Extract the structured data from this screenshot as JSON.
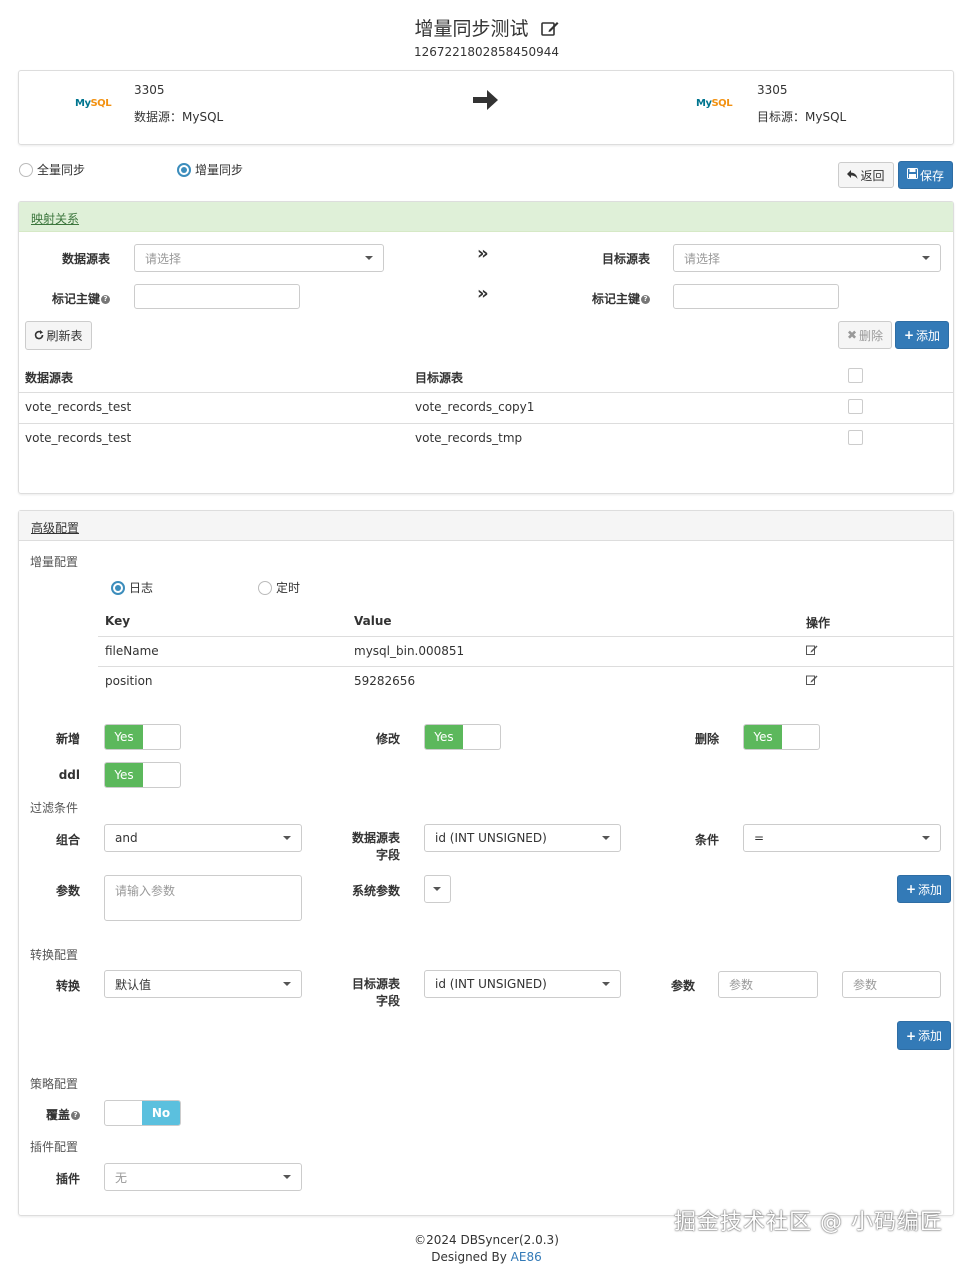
{
  "header": {
    "title": "增量同步测试",
    "id": "1267221802858450944"
  },
  "source": {
    "port": "3305",
    "label": "数据源：MySQL",
    "logo_main": "My",
    "logo_accent": "SQL"
  },
  "target": {
    "port": "3305",
    "label": "目标源：MySQL",
    "logo_main": "My",
    "logo_accent": "SQL"
  },
  "sync_mode": {
    "full": "全量同步",
    "incremental": "增量同步",
    "selected": "incremental"
  },
  "actions": {
    "back": "返回",
    "save": "保存"
  },
  "mapping": {
    "title": "映射关系",
    "source_table_label": "数据源表",
    "target_table_label": "目标源表",
    "source_pk_label": "标记主键",
    "target_pk_label": "标记主键",
    "select_placeholder": "请选择",
    "refresh": "刷新表",
    "delete": "删除",
    "add": "添加",
    "columns": [
      "数据源表",
      "目标源表"
    ],
    "rows": [
      {
        "source": "vote_records_test",
        "target": "vote_records_copy1"
      },
      {
        "source": "vote_records_test",
        "target": "vote_records_tmp"
      }
    ]
  },
  "advanced": {
    "title": "高级配置",
    "incremental_label": "增量配置",
    "mode_log": "日志",
    "mode_timer": "定时",
    "mode_selected": "log",
    "kv_headers": {
      "key": "Key",
      "value": "Value",
      "op": "操作"
    },
    "kv_rows": [
      {
        "key": "fileName",
        "value": "mysql_bin.000851"
      },
      {
        "key": "position",
        "value": "59282656"
      }
    ],
    "insert_label": "新增",
    "update_label": "修改",
    "delete_label": "删除",
    "ddl_label": "ddl",
    "yes": "Yes",
    "no": "No",
    "filter_label": "过滤条件",
    "combine_label": "组合",
    "combine_value": "and",
    "src_field_label_1": "数据源表",
    "src_field_label_2": "字段",
    "src_field_value": "id (INT UNSIGNED)",
    "condition_label": "条件",
    "condition_value": "=",
    "param_label": "参数",
    "param_placeholder": "请输入参数",
    "sys_param_label": "系统参数",
    "add": "添加",
    "convert_section_label": "转换配置",
    "convert_label": "转换",
    "convert_value": "默认值",
    "tgt_field_label_1": "目标源表",
    "tgt_field_label_2": "字段",
    "tgt_field_value": "id (INT UNSIGNED)",
    "convert_param_label": "参数",
    "convert_param_placeholder": "参数",
    "convert_param2_placeholder": "参数",
    "strategy_section_label": "策略配置",
    "overwrite_label": "覆盖",
    "plugin_section_label": "插件配置",
    "plugin_label": "插件",
    "plugin_value": "无"
  },
  "footer": {
    "copyright": "©2024 DBSyncer(2.0.3)",
    "designed_by": "Designed By",
    "author": "AE86"
  },
  "watermark": "掘金技术社区 @ 小码编匠",
  "colors": {
    "primary": "#337ab7",
    "success": "#5cb85c",
    "info": "#5bc0de",
    "panel_green": "#dff0d8"
  }
}
